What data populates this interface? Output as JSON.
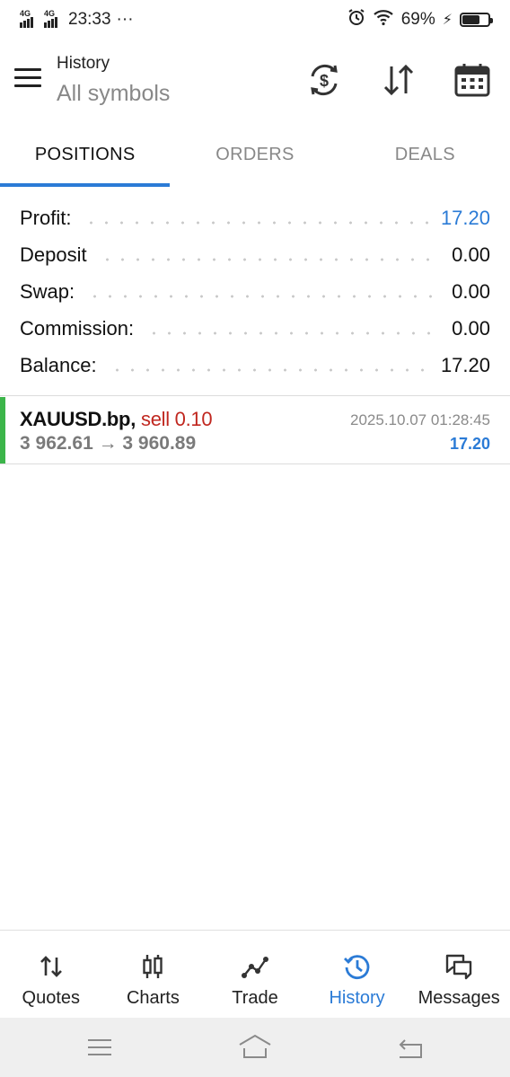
{
  "status_bar": {
    "network1": "4G",
    "network2": "4G",
    "time": "23:33",
    "more": "···",
    "battery_percent": "69%",
    "battery_level": 0.69
  },
  "app_bar": {
    "title": "History",
    "subtitle": "All symbols",
    "icons": [
      "currency-sync-icon",
      "sort-icon",
      "calendar-icon"
    ]
  },
  "tabs": [
    {
      "label": "POSITIONS",
      "active": true
    },
    {
      "label": "ORDERS",
      "active": false
    },
    {
      "label": "DEALS",
      "active": false
    }
  ],
  "summary": [
    {
      "label": "Profit:",
      "value": "17.20",
      "color": "#2b7bd6"
    },
    {
      "label": "Deposit",
      "value": "0.00"
    },
    {
      "label": "Swap:",
      "value": "0.00"
    },
    {
      "label": "Commission:",
      "value": "0.00"
    },
    {
      "label": "Balance:",
      "value": "17.20"
    }
  ],
  "positions": [
    {
      "symbol": "XAUUSD.bp,",
      "type": "sell 0.10",
      "prices": "3 962.61 → 3 960.89",
      "time": "2025.10.07 01:28:45",
      "profit": "17.20",
      "indicator_color": "#3cb54a"
    }
  ],
  "bottom_nav": [
    {
      "label": "Quotes",
      "icon": "quotes-icon",
      "active": false
    },
    {
      "label": "Charts",
      "icon": "candlestick-icon",
      "active": false
    },
    {
      "label": "Trade",
      "icon": "trade-icon",
      "active": false
    },
    {
      "label": "History",
      "icon": "history-icon",
      "active": true
    },
    {
      "label": "Messages",
      "icon": "messages-icon",
      "active": false
    }
  ],
  "colors": {
    "accent": "#2b7bd6",
    "sell": "#c0271f",
    "positive_bar": "#3cb54a"
  }
}
